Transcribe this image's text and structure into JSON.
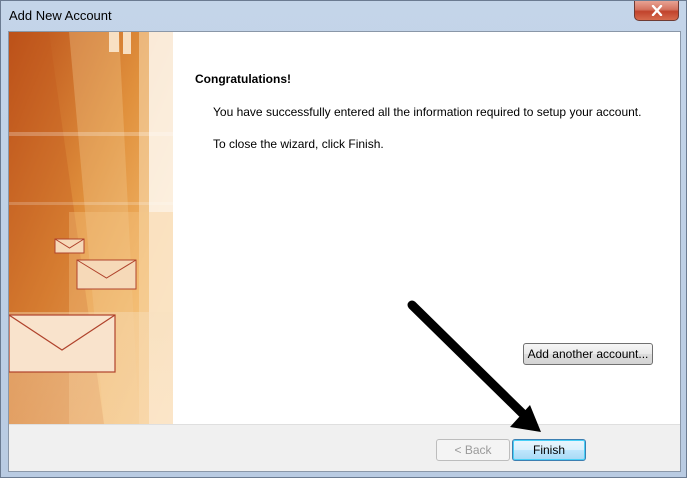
{
  "window": {
    "title": "Add New Account",
    "close_icon": "close-icon"
  },
  "main": {
    "heading": "Congratulations!",
    "message1": "You have successfully entered all the information required to setup your account.",
    "message2": "To close the wizard, click Finish.",
    "add_another_label": "Add another account..."
  },
  "footer": {
    "back_label": "< Back",
    "finish_label": "Finish"
  },
  "colors": {
    "accent": "#c1432c",
    "sidebar": "#e09a4a"
  }
}
